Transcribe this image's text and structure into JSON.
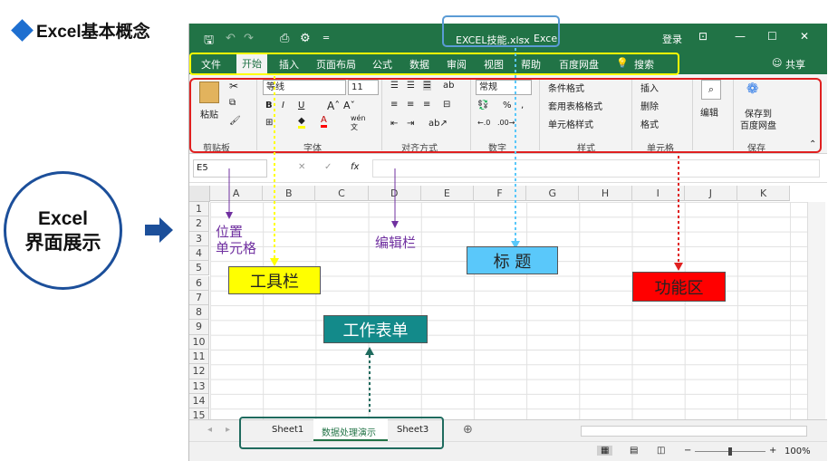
{
  "heading": "Excel基本概念",
  "circle": {
    "line1": "Excel",
    "line2": "界面展示"
  },
  "titlebar": {
    "filename": "EXCEL技能.xlsx",
    "sep": "-",
    "app": "Excel",
    "login": "登录",
    "minimize": "—",
    "maximize": "☐",
    "close": "✕"
  },
  "tabs": [
    "文件",
    "开始",
    "插入",
    "页面布局",
    "公式",
    "数据",
    "审阅",
    "视图",
    "帮助",
    "百度网盘",
    "搜索"
  ],
  "share": "共享",
  "ribbon": {
    "paste": "粘贴",
    "clipboard": "剪贴板",
    "font_name": "等线",
    "font_size": "11",
    "font": "字体",
    "align": "对齐方式",
    "number_format": "常规",
    "number": "数字",
    "cond_format": "条件格式",
    "table_format": "套用表格格式",
    "cell_style": "单元格样式",
    "styles": "样式",
    "insert": "插入",
    "delete": "删除",
    "format": "格式",
    "cells": "单元格",
    "edit": "编辑",
    "save_baidu_1": "保存到",
    "save_baidu_2": "百度网盘",
    "save": "保存",
    "bold": "B",
    "italic": "I",
    "underline": "U",
    "wen": "wén",
    "wen_char": "文"
  },
  "formula": {
    "namebox": "E5",
    "cancel": "✕",
    "enter": "✓",
    "fx": "fx"
  },
  "columns": [
    "A",
    "B",
    "C",
    "D",
    "E",
    "F",
    "G",
    "H",
    "I",
    "J",
    "K"
  ],
  "rows": [
    "1",
    "2",
    "3",
    "4",
    "5",
    "6",
    "7",
    "8",
    "9",
    "10",
    "11",
    "12",
    "13",
    "14",
    "15"
  ],
  "sheets": [
    "Sheet1",
    "数据处理演示",
    "Sheet3"
  ],
  "active_sheet_index": 1,
  "zoom": "100%",
  "annotations": {
    "position_cell_1": "位置",
    "position_cell_2": "单元格",
    "edit_bar": "编辑栏",
    "title": "标  题",
    "toolbar": "工具栏",
    "function_area": "功能区",
    "worksheet": "工作表单"
  },
  "colors": {
    "excel_green": "#217346",
    "highlight_blue": "#5b9bd5",
    "toolbar_yellow": "#ffff00",
    "function_red": "#ff0000",
    "title_cyan": "#5ac8fa",
    "worksheet_teal": "#138a8a",
    "frame_red": "#e02020",
    "frame_yellow": "#ffff00",
    "frame_teal": "#1f6b5e"
  }
}
